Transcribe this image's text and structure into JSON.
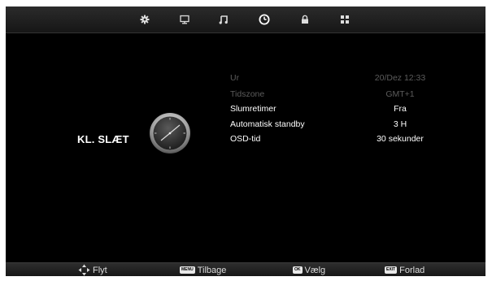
{
  "top_tabs": [
    {
      "icon": "gear-icon"
    },
    {
      "icon": "monitor-icon"
    },
    {
      "icon": "music-note-icon"
    },
    {
      "icon": "clock-icon",
      "selected": true
    },
    {
      "icon": "lock-icon"
    },
    {
      "icon": "grid-icon"
    }
  ],
  "page": {
    "title": "KL. SLÆT",
    "icon": "analog-clock-icon"
  },
  "settings": [
    {
      "label": "Ur",
      "value": "20/Dez  12:33",
      "enabled": false
    },
    {
      "label": "Tidszone",
      "value": "GMT+1",
      "enabled": false
    },
    {
      "label": "Slumretimer",
      "value": "Fra",
      "enabled": true
    },
    {
      "label": "Automatisk standby",
      "value": "3 H",
      "enabled": true
    },
    {
      "label": "OSD-tid",
      "value": "30 sekunder",
      "enabled": true
    }
  ],
  "footer": {
    "move": {
      "icon": "dpad-icon",
      "label": "Flyt"
    },
    "back": {
      "key": "MENU",
      "label": "Tilbage"
    },
    "select": {
      "key": "OK",
      "label": "Vælg"
    },
    "exit": {
      "key": "EXIT",
      "label": "Forlad"
    }
  },
  "colors": {
    "background": "#000000",
    "text_active": "#ffffff",
    "text_disabled": "#5c5c5c",
    "bar": "#222222"
  }
}
